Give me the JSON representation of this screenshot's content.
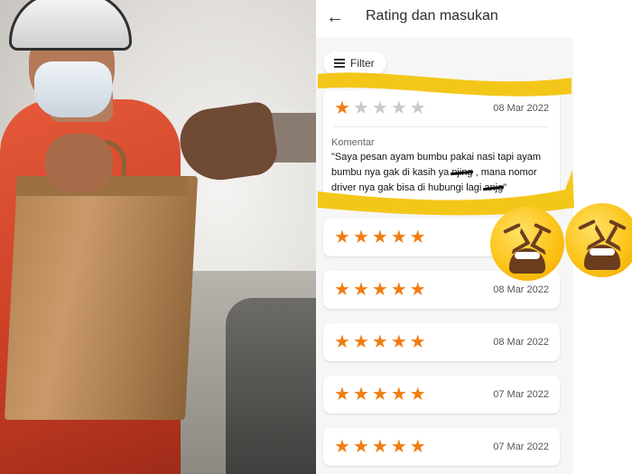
{
  "header": {
    "title": "Rating dan masukan",
    "back_icon": "arrow-left-icon"
  },
  "filter": {
    "label": "Filter",
    "icon": "sliders-icon"
  },
  "reviews": [
    {
      "rating": 1,
      "date": "08 Mar 2022",
      "comment_label": "Komentar",
      "comment": {
        "part1": "\"Saya pesan ayam bumbu pakai nasi tapi ayam bumbu nya gak di kasih ya ",
        "censor1": "njing",
        "part2": " , mana nomor driver nya gak bisa di hubungi lagi ",
        "censor2": "anjg",
        "part3": "\""
      }
    },
    {
      "rating": 5,
      "date": ""
    },
    {
      "rating": 5,
      "date": "08 Mar 2022"
    },
    {
      "rating": 5,
      "date": "08 Mar 2022"
    },
    {
      "rating": 5,
      "date": "07 Mar 2022"
    },
    {
      "rating": 5,
      "date": "07 Mar 2022"
    }
  ],
  "colors": {
    "star_on": "#f07d12",
    "star_off": "#c9c9c9",
    "highlighter": "#f2c40e"
  },
  "decorations": {
    "emoji": "weary-face-icon",
    "photo": "delivery-courier-photo"
  }
}
